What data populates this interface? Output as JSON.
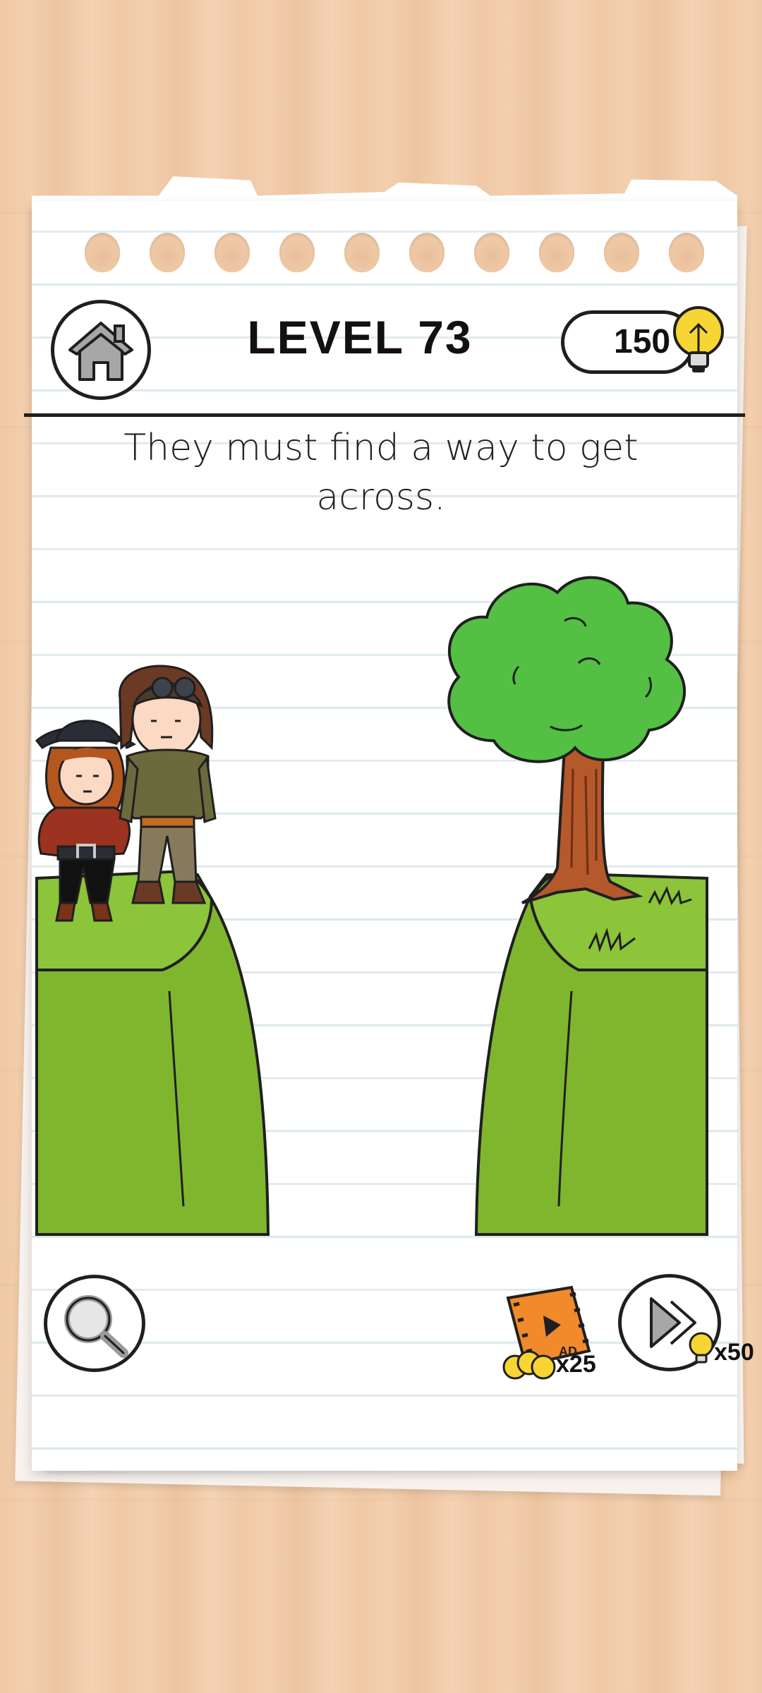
{
  "header": {
    "level_title": "LEVEL 73",
    "coins": "150"
  },
  "instruction": "They must find a way to get across.",
  "bottom_bar": {
    "ad_reward": "x25",
    "skip_cost": "x50"
  },
  "icons": {
    "home": "home-icon",
    "hint": "magnifier-icon",
    "skip": "fast-forward-icon",
    "coin": "lightbulb-icon",
    "ad": "film-ad-icon"
  },
  "colors": {
    "grass": "#7fb62e",
    "tree_leaves": "#53c043",
    "trunk": "#b5582c",
    "bulb": "#f7d532"
  }
}
